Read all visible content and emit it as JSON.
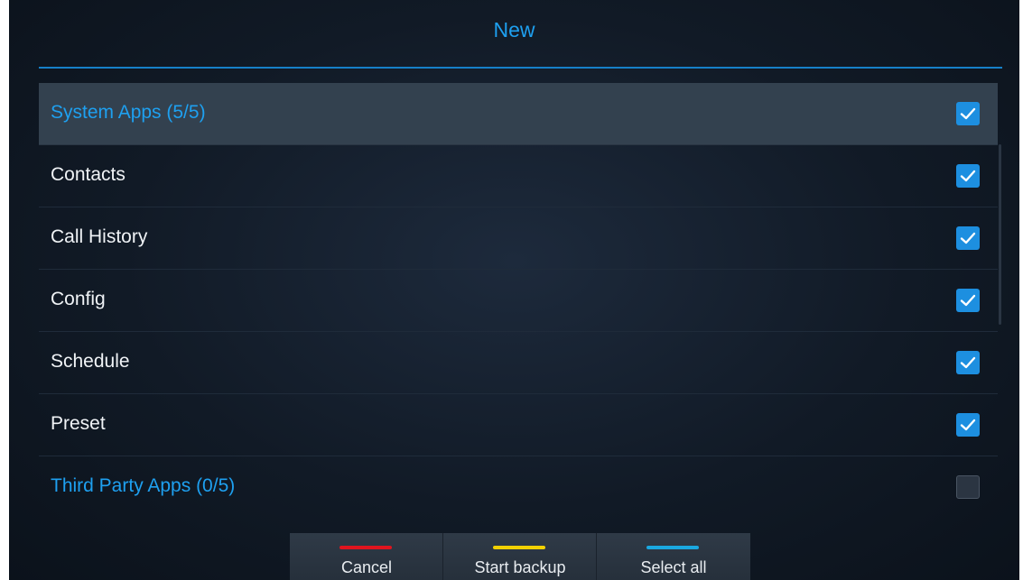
{
  "dialog": {
    "title": "New"
  },
  "list": {
    "items": [
      {
        "label": "System Apps  (5/5)",
        "type": "group",
        "checked": true,
        "selected": true
      },
      {
        "label": "Contacts",
        "type": "item",
        "checked": true,
        "selected": false
      },
      {
        "label": "Call History",
        "type": "item",
        "checked": true,
        "selected": false
      },
      {
        "label": "Config",
        "type": "item",
        "checked": true,
        "selected": false
      },
      {
        "label": "Schedule",
        "type": "item",
        "checked": true,
        "selected": false
      },
      {
        "label": "Preset",
        "type": "item",
        "checked": true,
        "selected": false
      },
      {
        "label": "Third Party Apps  (0/5)",
        "type": "group",
        "checked": false,
        "selected": false
      }
    ]
  },
  "buttons": {
    "cancel": {
      "label": "Cancel",
      "color": "#e0141e"
    },
    "start_backup": {
      "label": "Start backup",
      "color": "#f2d100"
    },
    "select_all": {
      "label": "Select all",
      "color": "#1aa8e0"
    }
  },
  "colors": {
    "accent": "#1ea0f0",
    "checkbox_on": "#1d8fe0"
  }
}
